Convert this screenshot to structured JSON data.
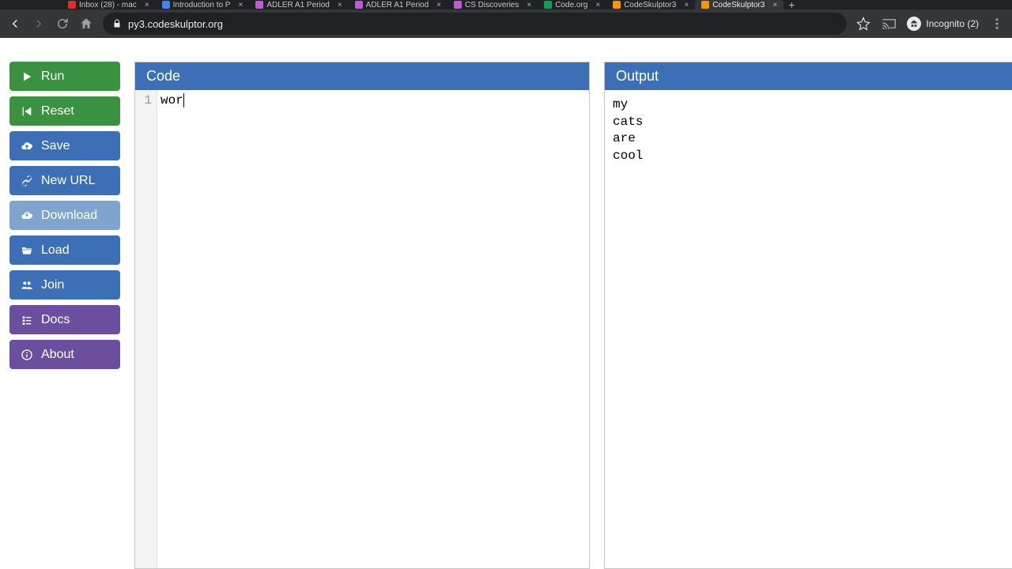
{
  "browser": {
    "tabs": [
      {
        "label": "Inbox (28) - mac",
        "fav": "#d93025"
      },
      {
        "label": "Introduction to P",
        "fav": "#4285f4"
      },
      {
        "label": "ADLER A1 Period",
        "fav": "#c05ad0"
      },
      {
        "label": "ADLER A1 Period",
        "fav": "#c05ad0"
      },
      {
        "label": "CS Discoveries",
        "fav": "#c05ad0"
      },
      {
        "label": "Code.org",
        "fav": "#0f9d58"
      },
      {
        "label": "CodeSkulptor3",
        "fav": "#f29900"
      },
      {
        "label": "CodeSkulptor3",
        "fav": "#f29900",
        "active": true
      }
    ],
    "url": "py3.codeskulptor.org",
    "incognito_label": "Incognito (2)"
  },
  "sidebar": {
    "run": "Run",
    "reset": "Reset",
    "save": "Save",
    "newurl": "New URL",
    "download": "Download",
    "load": "Load",
    "join": "Join",
    "docs": "Docs",
    "about": "About"
  },
  "panels": {
    "code_title": "Code",
    "output_title": "Output"
  },
  "editor": {
    "lines": [
      {
        "num": "1",
        "text": "wor"
      }
    ]
  },
  "output_text": "my\ncats\nare\ncool"
}
